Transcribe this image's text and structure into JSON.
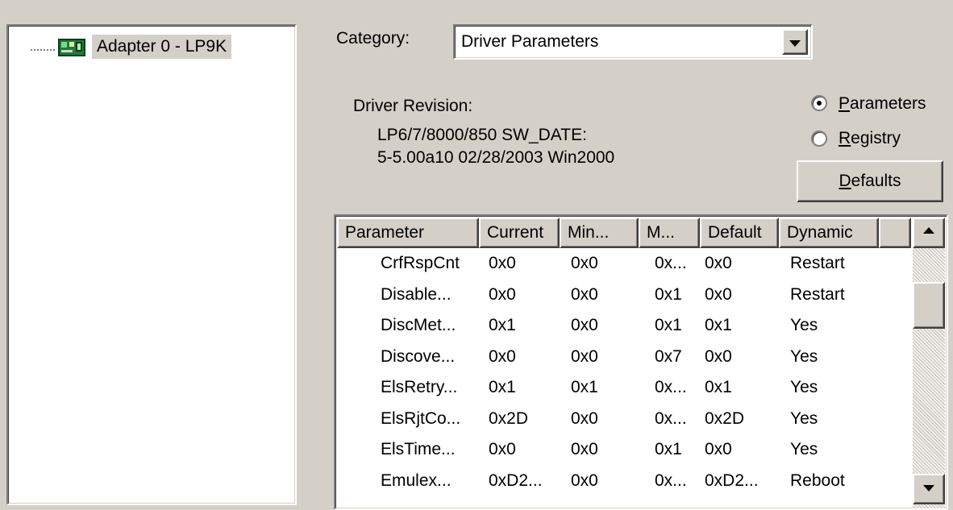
{
  "tree": {
    "item_label": "Adapter 0 - LP9K",
    "icon": "network-adapter-icon"
  },
  "category": {
    "label": "Category:",
    "value": "Driver Parameters"
  },
  "driver": {
    "revision_label": "Driver Revision:",
    "line1": "LP6/7/8000/850 SW_DATE:",
    "line2": "5-5.00a10 02/28/2003 Win2000"
  },
  "view": {
    "parameters_label": "Parameters",
    "registry_label": "Registry",
    "selected": "Parameters"
  },
  "buttons": {
    "defaults_label": "Defaults"
  },
  "table": {
    "columns": [
      "Parameter",
      "Current",
      "Min...",
      "M...",
      "Default",
      "Dynamic"
    ],
    "rows": [
      [
        "CrfRspCnt",
        "0x0",
        "0x0",
        "0x...",
        "0x0",
        "Restart"
      ],
      [
        "Disable...",
        "0x0",
        "0x0",
        "0x1",
        "0x0",
        "Restart"
      ],
      [
        "DiscMet...",
        "0x1",
        "0x0",
        "0x1",
        "0x1",
        "Yes"
      ],
      [
        "Discove...",
        "0x0",
        "0x0",
        "0x7",
        "0x0",
        "Yes"
      ],
      [
        "ElsRetry...",
        "0x1",
        "0x1",
        "0x...",
        "0x1",
        "Yes"
      ],
      [
        "ElsRjtCo...",
        "0x2D",
        "0x0",
        "0x...",
        "0x2D",
        "Yes"
      ],
      [
        "ElsTime...",
        "0x0",
        "0x0",
        "0x1",
        "0x0",
        "Yes"
      ],
      [
        "Emulex...",
        "0xD2...",
        "0x0",
        "0x...",
        "0xD2...",
        "Reboot"
      ]
    ]
  },
  "colors": {
    "face": "#d4d0c8",
    "adapter_icon": "#2e8b57"
  }
}
